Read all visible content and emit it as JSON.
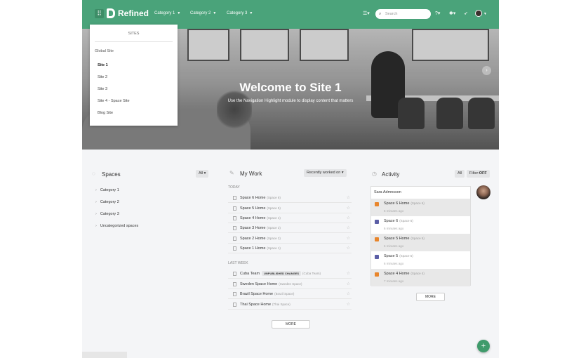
{
  "header": {
    "brand": "Refined",
    "categories": [
      {
        "label": "Category 1"
      },
      {
        "label": "Category 2"
      },
      {
        "label": "Category 3"
      }
    ],
    "search_placeholder": "Search",
    "menu_icon": "grid-icon",
    "list_icon": "list-icon",
    "help_icon": "help-icon",
    "settings_icon": "gear-icon",
    "notify_icon": "rocket-icon"
  },
  "sites_menu": {
    "heading": "SITES",
    "global": "Global Site",
    "items": [
      {
        "label": "Site 1"
      },
      {
        "label": "Site 2"
      },
      {
        "label": "Site 3"
      },
      {
        "label": "Site 4 - Space Site"
      },
      {
        "label": "Blog Site"
      }
    ],
    "active_item": "Site 1"
  },
  "hero": {
    "title": "Welcome to Site 1",
    "subtitle": "Use the Navigation Highlight module to display content that matters"
  },
  "spaces": {
    "title": "Spaces",
    "filter": "All",
    "items": [
      {
        "label": "Category 1"
      },
      {
        "label": "Category 2"
      },
      {
        "label": "Category 3"
      },
      {
        "label": "Uncategorized spaces"
      }
    ]
  },
  "my_work": {
    "title": "My Work",
    "sort": "Recently worked on",
    "sections": [
      {
        "label": "TODAY",
        "rows": [
          {
            "title": "Space 6 Home",
            "space": "(Space 6)"
          },
          {
            "title": "Space 5 Home",
            "space": "(Space 5)"
          },
          {
            "title": "Space 4 Home",
            "space": "(Space 4)"
          },
          {
            "title": "Space 3 Home",
            "space": "(Space 3)"
          },
          {
            "title": "Space 2 Home",
            "space": "(Space 2)"
          },
          {
            "title": "Space 1 Home",
            "space": "(Space 1)"
          }
        ]
      },
      {
        "label": "LAST WEEK",
        "rows": [
          {
            "title": "Cuba Team",
            "badge": "UNPUBLISHED CHANGES",
            "space": "(Cuba Team)"
          },
          {
            "title": "Sweden Space Home",
            "space": "(Sweden Space)"
          },
          {
            "title": "Brazil Space Home",
            "space": "(Brazil Space)"
          },
          {
            "title": "Thai Space Home",
            "space": "(Thai Space)"
          }
        ]
      }
    ],
    "more": "MORE"
  },
  "activity": {
    "title": "Activity",
    "filter_all": "All",
    "filter_label": "Filter:",
    "filter_value": "OFF",
    "user": "Sara Admnsson",
    "items": [
      {
        "title": "Space 6 Home",
        "space": "(Space 6)",
        "time": "6 minutes ago",
        "icon": "page-icon",
        "color": "#e8852b"
      },
      {
        "title": "Space 6",
        "space": "(Space 6)",
        "time": "6 minutes ago",
        "icon": "space-icon",
        "color": "#5b5ea6"
      },
      {
        "title": "Space 5 Home",
        "space": "(Space 5)",
        "time": "6 minutes ago",
        "icon": "page-icon",
        "color": "#e8852b"
      },
      {
        "title": "Space 5",
        "space": "(Space 5)",
        "time": "6 minutes ago",
        "icon": "space-icon",
        "color": "#5b5ea6"
      },
      {
        "title": "Space 4 Home",
        "space": "(Space 4)",
        "time": "7 minutes ago",
        "icon": "page-icon",
        "color": "#e8852b"
      }
    ],
    "more": "MORE"
  },
  "fab_label": "+",
  "colors": {
    "brand_green": "#4aa37a",
    "fab_green": "#3f9b6b"
  }
}
